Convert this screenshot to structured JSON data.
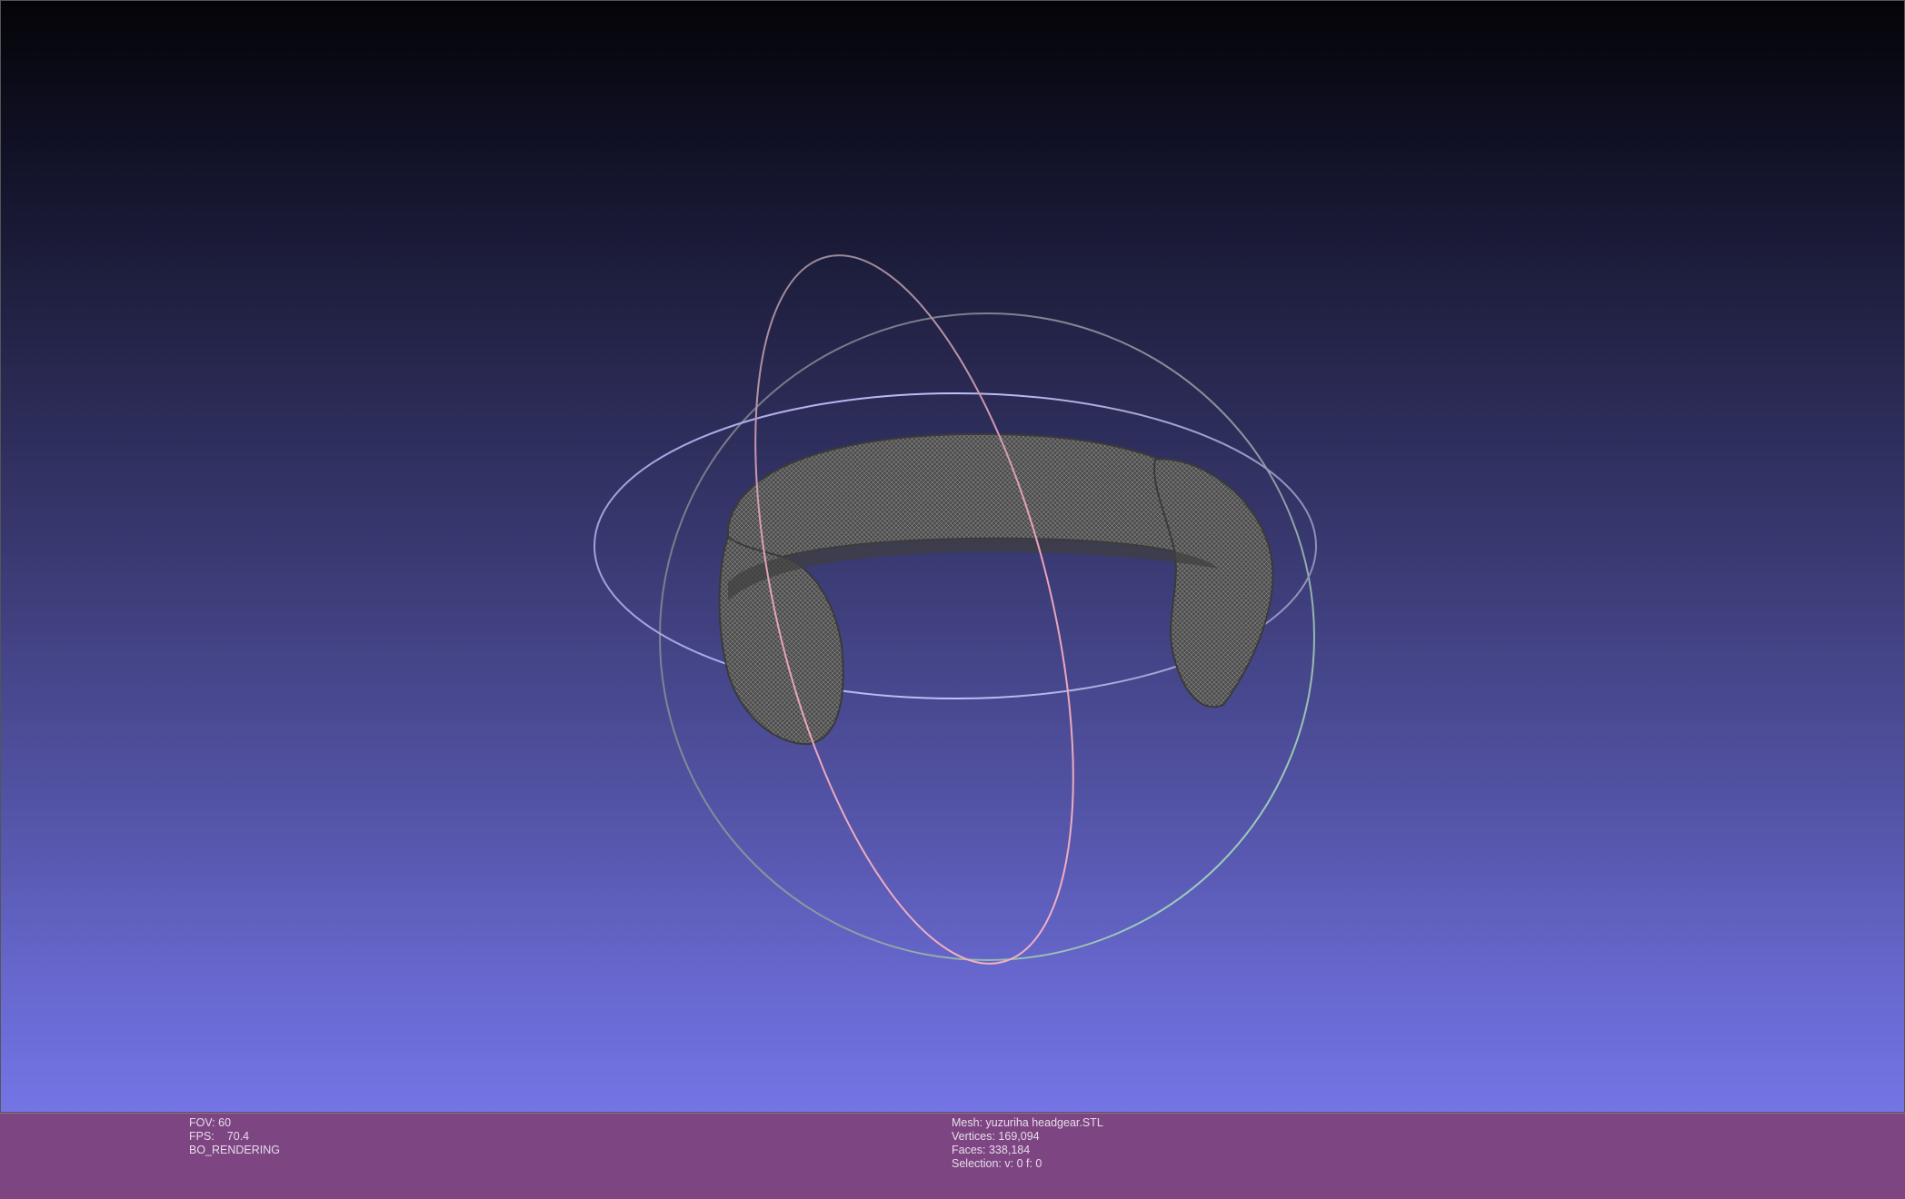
{
  "colors": {
    "background_top": "#040408",
    "background_bottom": "#7474e6",
    "info_bar": "#7d4683",
    "mesh": "#4a4a4a",
    "trackball_x": "#e8a0b0",
    "trackball_y": "#a0e0c0",
    "trackball_z": "#b0b0f0"
  },
  "left_info": {
    "fov": "FOV: 60",
    "fps_label": "FPS:",
    "fps_value": "70.4",
    "rendering": "BO_RENDERING"
  },
  "right_info": {
    "mesh": "Mesh: yuzuriha headgear.STL",
    "vertices": "Vertices: 169,094",
    "faces": "Faces: 338,184",
    "selection": "Selection: v: 0 f: 0"
  }
}
